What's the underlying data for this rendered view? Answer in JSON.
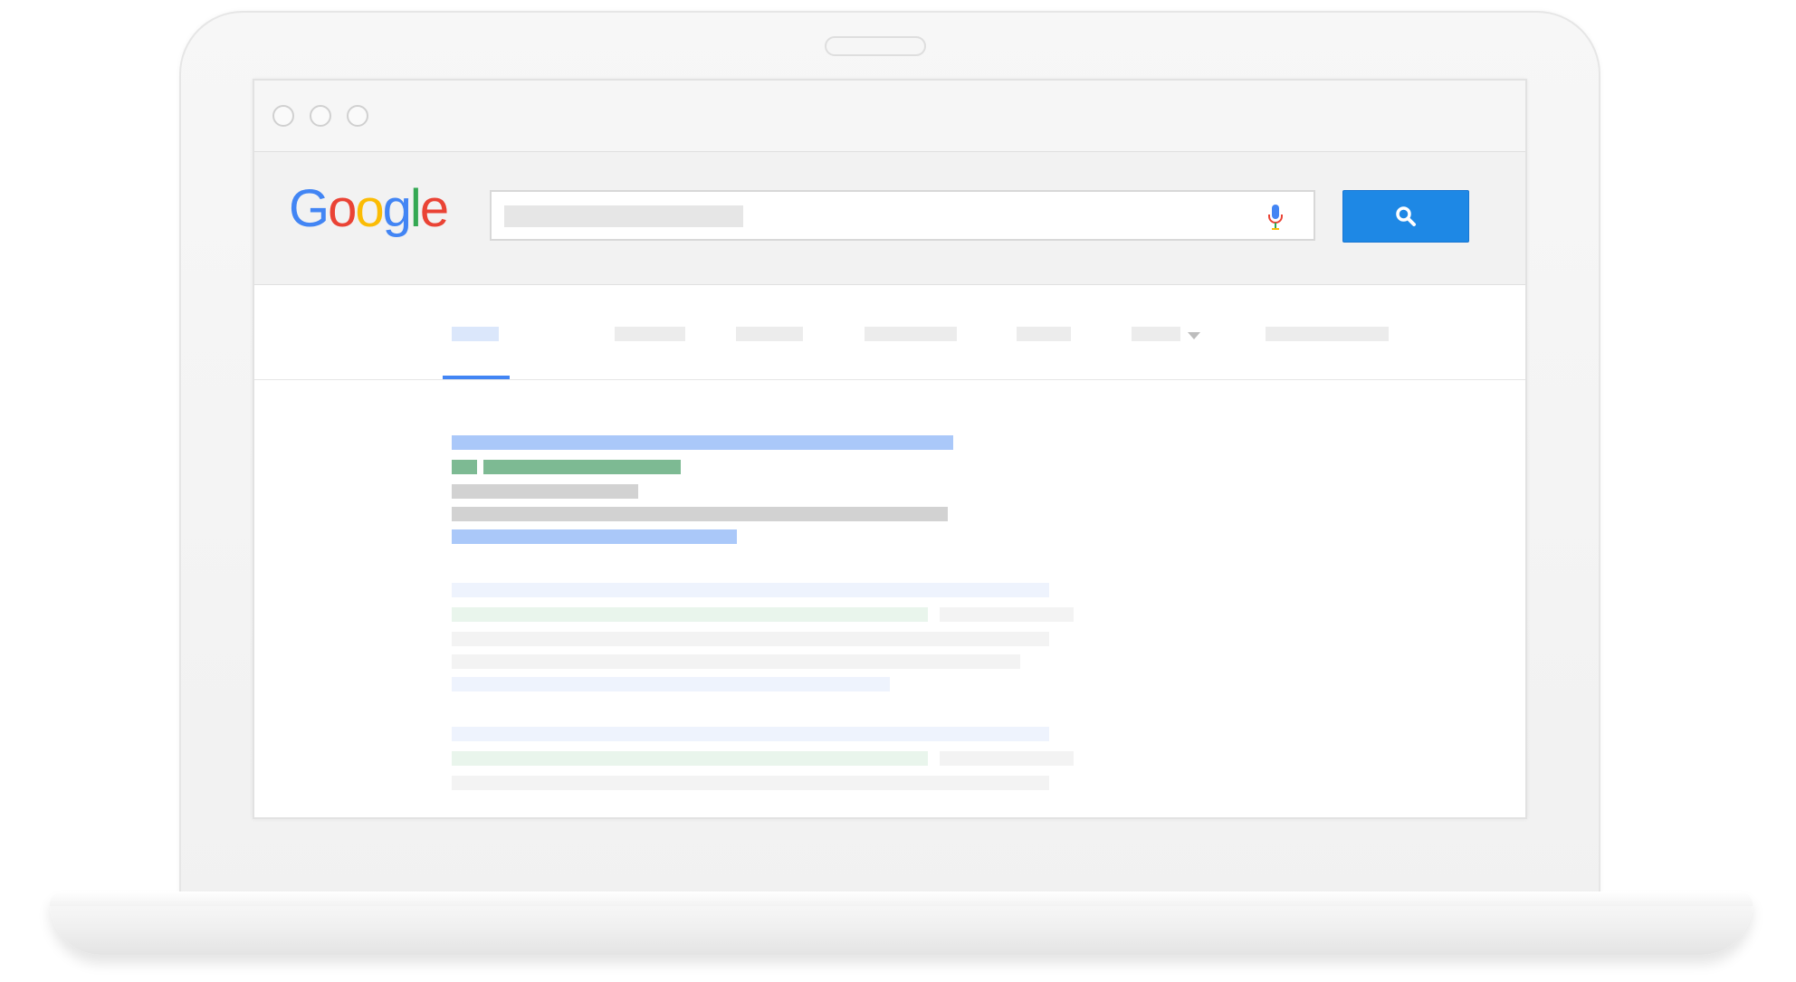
{
  "scene": "laptop-mockup",
  "browser": {
    "window_controls": [
      "close",
      "minimize",
      "maximize"
    ]
  },
  "search": {
    "logo": {
      "letters": [
        {
          "char": "G",
          "color": "#4285F4"
        },
        {
          "char": "o",
          "color": "#EA4335"
        },
        {
          "char": "o",
          "color": "#FBBC05"
        },
        {
          "char": "g",
          "color": "#4285F4"
        },
        {
          "char": "l",
          "color": "#34A853"
        },
        {
          "char": "e",
          "color": "#EA4335"
        }
      ]
    },
    "input_value": "",
    "mic_icon": "microphone-icon",
    "button_icon": "search-icon",
    "button_color": "#1E88E5"
  },
  "tabs": {
    "active_index": 0,
    "items": [
      {
        "label": "",
        "placeholder": true
      },
      {
        "label": "",
        "placeholder": true
      },
      {
        "label": "",
        "placeholder": true
      },
      {
        "label": "",
        "placeholder": true
      },
      {
        "label": "",
        "placeholder": true
      },
      {
        "label": "",
        "placeholder": true,
        "has_dropdown": true
      },
      {
        "label": "",
        "placeholder": true
      }
    ],
    "accent_color": "#4285F4"
  },
  "results": {
    "focused_index": 0,
    "items": [
      {
        "title": "",
        "url": "",
        "snippet": "",
        "link": "",
        "emphasis": "focused"
      },
      {
        "title": "",
        "url": "",
        "snippet": "",
        "emphasis": "faded"
      },
      {
        "title": "",
        "url": "",
        "snippet": "",
        "emphasis": "faded"
      }
    ],
    "colors": {
      "title": "#AAC8F9",
      "url": "#7DBA93",
      "snippet": "#D2D2D2"
    }
  }
}
